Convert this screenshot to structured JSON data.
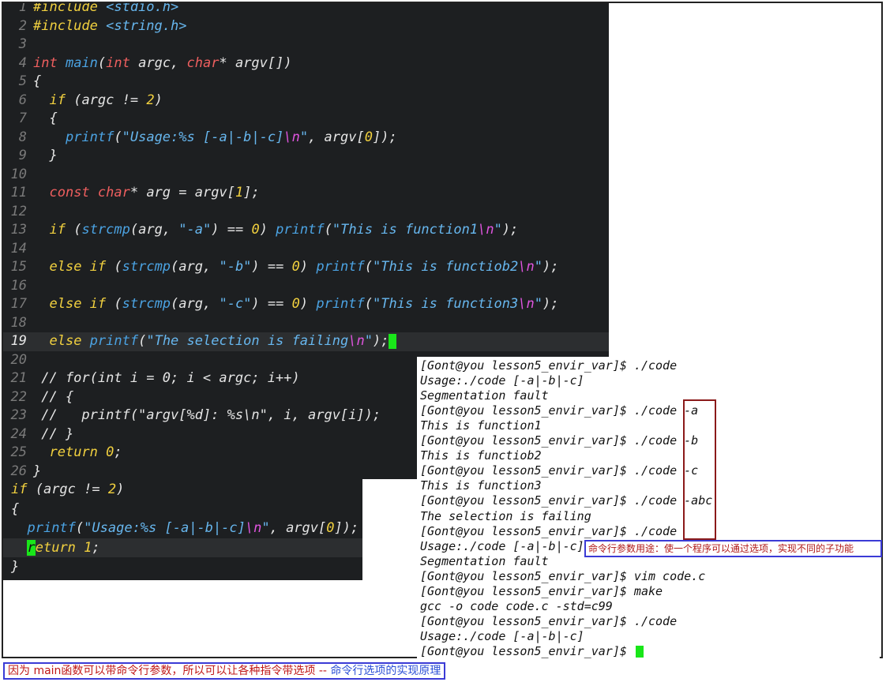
{
  "editor": {
    "current_line": 19,
    "lines": [
      {
        "n": "1",
        "spans": [
          [
            "kw-ctrl",
            "#include "
          ],
          [
            "str",
            "<stdio.h>"
          ]
        ]
      },
      {
        "n": "2",
        "spans": [
          [
            "kw-ctrl",
            "#include "
          ],
          [
            "str",
            "<string.h>"
          ]
        ]
      },
      {
        "n": "3",
        "spans": []
      },
      {
        "n": "4",
        "spans": [
          [
            "kw-type",
            "int "
          ],
          [
            "fn",
            "main"
          ],
          [
            "",
            "("
          ],
          [
            "kw-type",
            "int "
          ],
          [
            "",
            "argc, "
          ],
          [
            "kw-type",
            "char"
          ],
          [
            "",
            "* argv[])"
          ]
        ]
      },
      {
        "n": "5",
        "spans": [
          [
            "",
            "{"
          ]
        ]
      },
      {
        "n": "6",
        "spans": [
          [
            "",
            "  "
          ],
          [
            "kw-ctrl",
            "if "
          ],
          [
            "",
            "(argc != "
          ],
          [
            "num",
            "2"
          ],
          [
            "",
            ")"
          ]
        ]
      },
      {
        "n": "7",
        "spans": [
          [
            "",
            "  {"
          ]
        ]
      },
      {
        "n": "8",
        "spans": [
          [
            "",
            "    "
          ],
          [
            "fn",
            "printf"
          ],
          [
            "",
            "("
          ],
          [
            "str",
            "\"Usage:%s [-a|-b|-c]"
          ],
          [
            "esc",
            "\\n"
          ],
          [
            "str",
            "\""
          ],
          [
            "",
            ", argv["
          ],
          [
            "num",
            "0"
          ],
          [
            "",
            "]);"
          ]
        ]
      },
      {
        "n": "9",
        "spans": [
          [
            "",
            "  }"
          ]
        ]
      },
      {
        "n": "10",
        "spans": []
      },
      {
        "n": "11",
        "spans": [
          [
            "",
            "  "
          ],
          [
            "kw-type",
            "const char"
          ],
          [
            "",
            "* arg = argv["
          ],
          [
            "num",
            "1"
          ],
          [
            "",
            "];"
          ]
        ]
      },
      {
        "n": "12",
        "spans": []
      },
      {
        "n": "13",
        "spans": [
          [
            "",
            "  "
          ],
          [
            "kw-ctrl",
            "if "
          ],
          [
            "",
            "("
          ],
          [
            "fn",
            "strcmp"
          ],
          [
            "",
            "(arg, "
          ],
          [
            "str",
            "\"-a\""
          ],
          [
            "",
            ") == "
          ],
          [
            "num",
            "0"
          ],
          [
            "",
            ") "
          ],
          [
            "fn",
            "printf"
          ],
          [
            "",
            "("
          ],
          [
            "str",
            "\"This is function1"
          ],
          [
            "esc",
            "\\n"
          ],
          [
            "str",
            "\""
          ],
          [
            "",
            ");"
          ]
        ]
      },
      {
        "n": "14",
        "spans": []
      },
      {
        "n": "15",
        "spans": [
          [
            "",
            "  "
          ],
          [
            "kw-ctrl",
            "else if "
          ],
          [
            "",
            "("
          ],
          [
            "fn",
            "strcmp"
          ],
          [
            "",
            "(arg, "
          ],
          [
            "str",
            "\"-b\""
          ],
          [
            "",
            ") == "
          ],
          [
            "num",
            "0"
          ],
          [
            "",
            ") "
          ],
          [
            "fn",
            "printf"
          ],
          [
            "",
            "("
          ],
          [
            "str",
            "\"This is functiob2"
          ],
          [
            "esc",
            "\\n"
          ],
          [
            "str",
            "\""
          ],
          [
            "",
            ");"
          ]
        ]
      },
      {
        "n": "16",
        "spans": []
      },
      {
        "n": "17",
        "spans": [
          [
            "",
            "  "
          ],
          [
            "kw-ctrl",
            "else if "
          ],
          [
            "",
            "("
          ],
          [
            "fn",
            "strcmp"
          ],
          [
            "",
            "(arg, "
          ],
          [
            "str",
            "\"-c\""
          ],
          [
            "",
            ") == "
          ],
          [
            "num",
            "0"
          ],
          [
            "",
            ") "
          ],
          [
            "fn",
            "printf"
          ],
          [
            "",
            "("
          ],
          [
            "str",
            "\"This is function3"
          ],
          [
            "esc",
            "\\n"
          ],
          [
            "str",
            "\""
          ],
          [
            "",
            ");"
          ]
        ]
      },
      {
        "n": "18",
        "spans": []
      },
      {
        "n": "19",
        "spans": [
          [
            "",
            "  "
          ],
          [
            "kw-ctrl",
            "else "
          ],
          [
            "fn",
            "printf"
          ],
          [
            "",
            "("
          ],
          [
            "str",
            "\"The selection is failing"
          ],
          [
            "esc",
            "\\n"
          ],
          [
            "str",
            "\""
          ],
          [
            "",
            ");"
          ]
        ],
        "cursor": true
      },
      {
        "n": "20",
        "spans": []
      },
      {
        "n": "21",
        "spans": [
          [
            "cmt",
            " // for(int i = 0; i < argc; i++)"
          ]
        ]
      },
      {
        "n": "22",
        "spans": [
          [
            "cmt",
            " // {"
          ]
        ]
      },
      {
        "n": "23",
        "spans": [
          [
            "cmt",
            " //   printf(\"argv[%d]: %s\\n\", i, argv[i]);"
          ]
        ]
      },
      {
        "n": "24",
        "spans": [
          [
            "cmt",
            " // }"
          ]
        ]
      },
      {
        "n": "25",
        "spans": [
          [
            "",
            "  "
          ],
          [
            "kw-ctrl",
            "return "
          ],
          [
            "num",
            "0"
          ],
          [
            "",
            ";"
          ]
        ]
      },
      {
        "n": "26",
        "spans": [
          [
            "",
            "}"
          ]
        ]
      }
    ]
  },
  "snippet": {
    "lines": [
      {
        "spans": [
          [
            "kw-ctrl",
            "if "
          ],
          [
            "",
            "(argc != "
          ],
          [
            "num",
            "2"
          ],
          [
            "",
            ")"
          ]
        ]
      },
      {
        "spans": [
          [
            "",
            "{"
          ]
        ]
      },
      {
        "spans": [
          [
            "",
            "  "
          ],
          [
            "fn",
            "printf"
          ],
          [
            "",
            "("
          ],
          [
            "str",
            "\"Usage:%s [-a|-b|-c]"
          ],
          [
            "esc",
            "\\n"
          ],
          [
            "str",
            "\""
          ],
          [
            "",
            ", argv["
          ],
          [
            "num",
            "0"
          ],
          [
            "",
            "]);"
          ]
        ]
      },
      {
        "spans": [
          [
            "",
            "  "
          ],
          [
            "cur-char",
            "r"
          ],
          [
            "kw-ctrl",
            "eturn "
          ],
          [
            "num",
            "1"
          ],
          [
            "",
            ";"
          ]
        ],
        "current": true
      },
      {
        "spans": [
          [
            "",
            "}"
          ]
        ]
      }
    ]
  },
  "terminal": {
    "lines": [
      "[Gont@you lesson5_envir_var]$ ./code",
      "Usage:./code [-a|-b|-c]",
      "Segmentation fault",
      "[Gont@you lesson5_envir_var]$ ./code -a",
      "This is function1",
      "[Gont@you lesson5_envir_var]$ ./code -b",
      "This is functiob2",
      "[Gont@you lesson5_envir_var]$ ./code -c",
      "This is function3",
      "[Gont@you lesson5_envir_var]$ ./code -abc",
      "The selection is failing",
      "[Gont@you lesson5_envir_var]$ ./code",
      "Usage:./code [-a|-b|-c]",
      "Segmentation fault",
      "[Gont@you lesson5_envir_var]$ vim code.c",
      "[Gont@you lesson5_envir_var]$ make",
      "gcc -o code code.c -std=c99",
      "[Gont@you lesson5_envir_var]$ ./code",
      "Usage:./code [-a|-b|-c]",
      "[Gont@you lesson5_envir_var]$ "
    ]
  },
  "annotations": {
    "note": "命令行参数用途：使一个程序可以通过选项，实现不同的子功能",
    "caption_red": "因为 main函数可以带命令行参数，所以可以让各种指令带选项 -- ",
    "caption_blue": "命令行选项的实现原理"
  },
  "colors": {
    "editor_bg": "#1d1f21",
    "cursor": "#19e619",
    "highlight_box": "#8b1a1a",
    "note_border": "#3b3bd6"
  }
}
